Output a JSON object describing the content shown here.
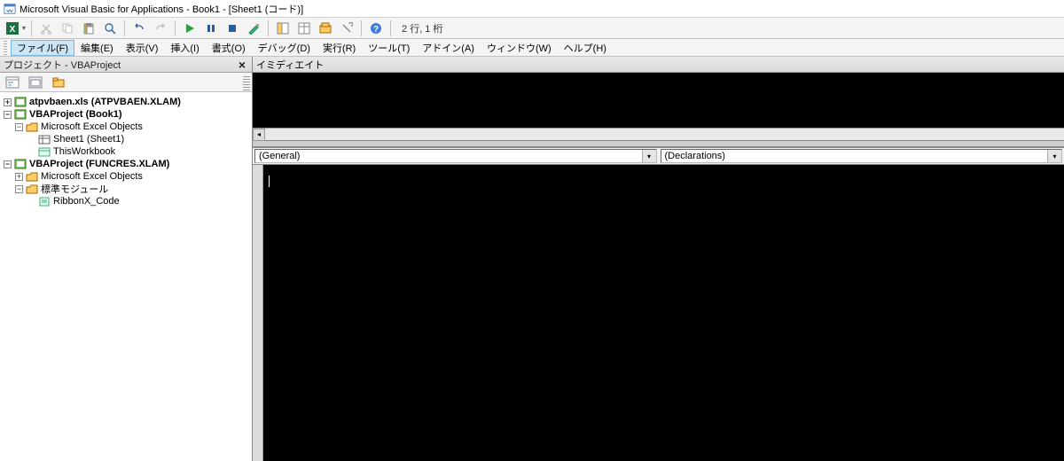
{
  "title": "Microsoft Visual Basic for Applications - Book1 - [Sheet1 (コード)]",
  "toolbar": {
    "status": "2 行, 1 桁"
  },
  "menu": {
    "file": "ファイル(F)",
    "edit": "編集(E)",
    "view": "表示(V)",
    "insert": "挿入(I)",
    "format": "書式(O)",
    "debug": "デバッグ(D)",
    "run": "実行(R)",
    "tools": "ツール(T)",
    "addins": "アドイン(A)",
    "window": "ウィンドウ(W)",
    "help": "ヘルプ(H)"
  },
  "project_pane": {
    "title": "プロジェクト - VBAProject",
    "tree": {
      "n1": "atpvbaen.xls (ATPVBAEN.XLAM)",
      "n2": "VBAProject (Book1)",
      "n2a": "Microsoft Excel Objects",
      "n2a1": "Sheet1 (Sheet1)",
      "n2a2": "ThisWorkbook",
      "n3": "VBAProject (FUNCRES.XLAM)",
      "n3a": "Microsoft Excel Objects",
      "n3b": "標準モジュール",
      "n3b1": "RibbonX_Code"
    }
  },
  "immediate": {
    "title": "イミディエイト"
  },
  "code": {
    "combo_left": "(General)",
    "combo_right": "(Declarations)"
  }
}
